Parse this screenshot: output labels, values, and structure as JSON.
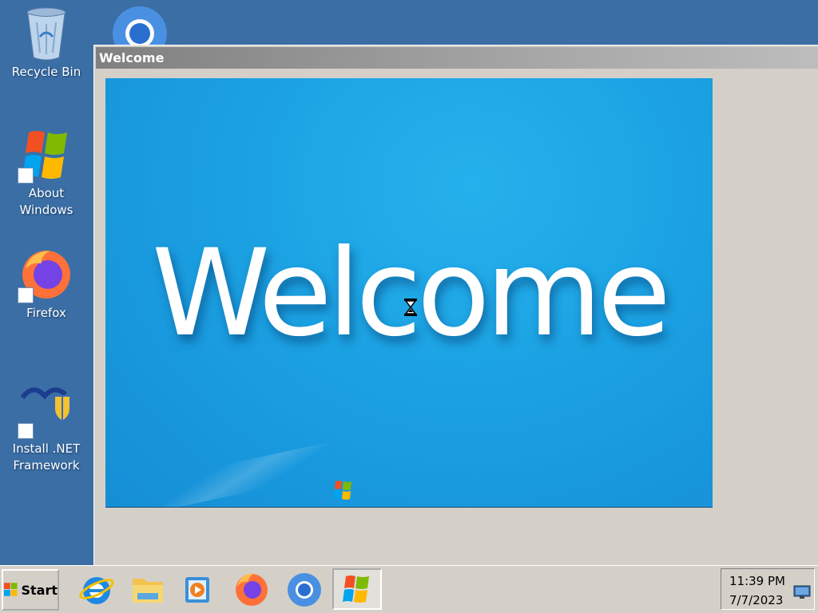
{
  "desktop": {
    "background_color": "#3a6ea5",
    "icons": [
      {
        "label": "Recycle Bin",
        "icon": "recycle-bin-icon"
      },
      {
        "label": "About Windows",
        "icon": "windows-logo-icon"
      },
      {
        "label": "Firefox",
        "icon": "firefox-icon"
      },
      {
        "label": "Install .NET Framework",
        "icon": "dotnet-installer-icon"
      },
      {
        "label": "",
        "icon": "chrome-icon"
      }
    ]
  },
  "window": {
    "title": "Welcome",
    "welcome_text": "Welcome",
    "accent_color": "#1ba1e2",
    "cursor": "hourglass-busy-cursor"
  },
  "taskbar": {
    "start_label": "Start",
    "pinned": [
      {
        "name": "Internet Explorer",
        "icon": "internet-explorer-icon"
      },
      {
        "name": "File Explorer",
        "icon": "folder-icon"
      },
      {
        "name": "Media Player",
        "icon": "media-player-icon"
      },
      {
        "name": "Firefox",
        "icon": "firefox-icon"
      },
      {
        "name": "Chrome",
        "icon": "chrome-icon"
      },
      {
        "name": "Welcome",
        "icon": "windows-logo-icon"
      }
    ],
    "clock": {
      "time": "11:39 PM",
      "date": "7/7/2023"
    }
  }
}
